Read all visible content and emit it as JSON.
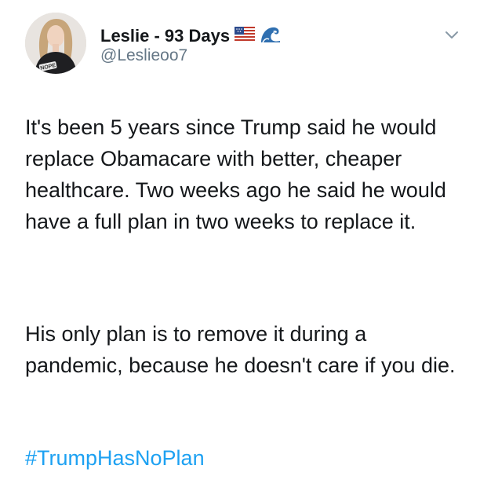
{
  "tweet": {
    "display_name": "Leslie - 93 Days",
    "name_emojis": [
      "us-flag-icon",
      "wave-icon"
    ],
    "handle": "@Leslieoo7",
    "avatar_shirt_text": "NOPE",
    "paragraphs": [
      "It's been 5 years since Trump said he would replace Obamacare with better, cheaper healthcare. Two weeks ago he said he would have a full plan in two weeks to replace it.",
      "His only plan is to remove it during a pandemic, because he doesn't care if you die."
    ],
    "hashtag": "#TrumpHasNoPlan"
  },
  "colors": {
    "text": "#14171a",
    "secondary": "#657786",
    "link": "#1da1f2"
  }
}
